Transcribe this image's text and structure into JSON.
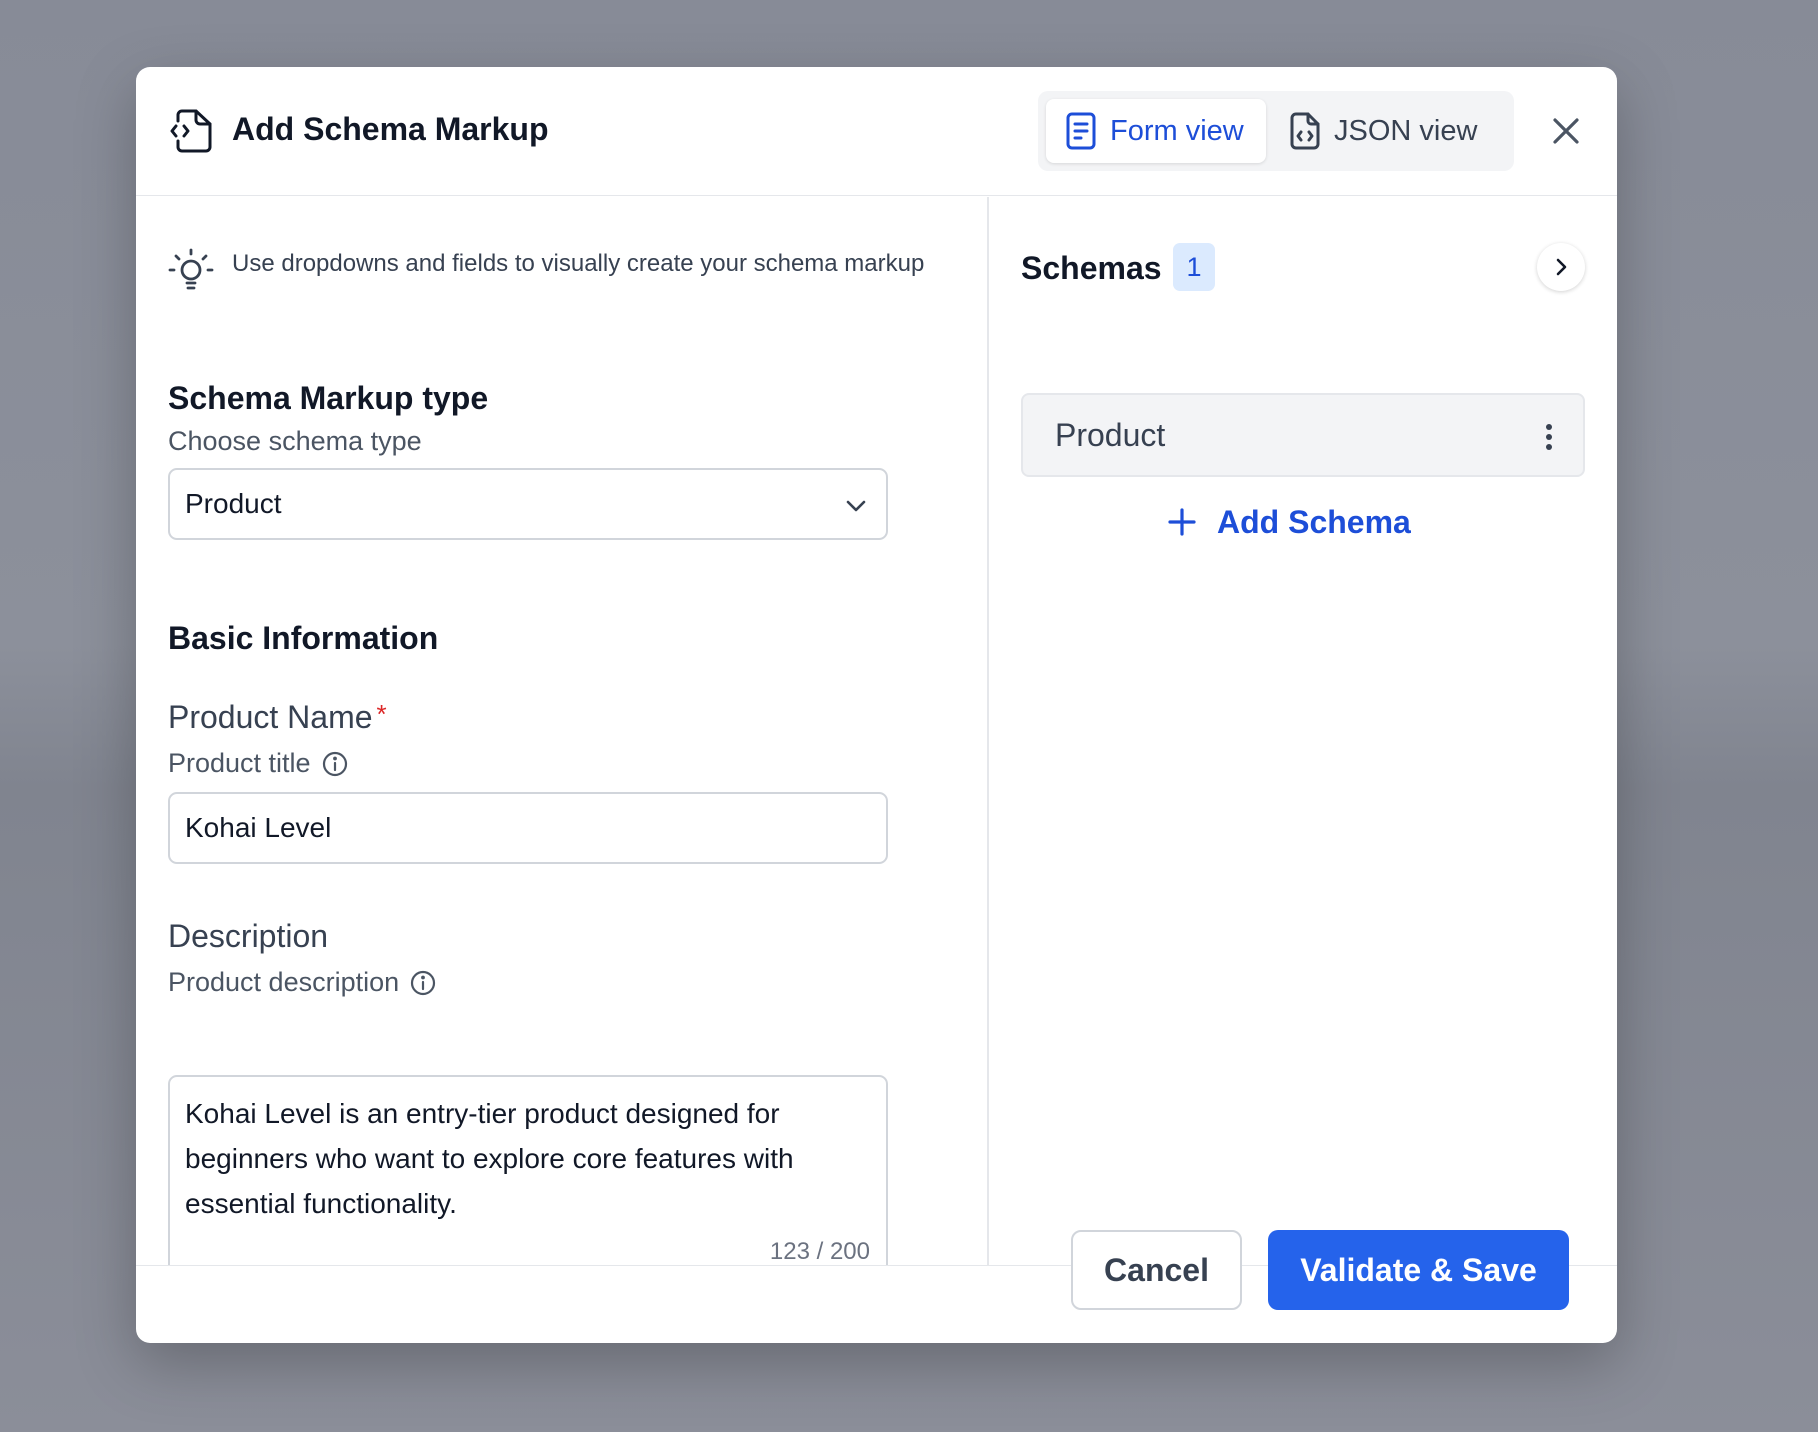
{
  "modal": {
    "title": "Add Schema Markup",
    "view_toggle": {
      "form_view_label": "Form view",
      "json_view_label": "JSON view",
      "active": "Form view"
    }
  },
  "form": {
    "tip": "Use dropdowns and fields to visually create your schema markup",
    "schema_type_section": {
      "title": "Schema Markup type",
      "help": "Choose schema type",
      "selected_value": "Product"
    },
    "basic_info_title": "Basic Information",
    "product_name": {
      "label": "Product Name",
      "required_mark": "*",
      "help": "Product title",
      "value": "Kohai Level"
    },
    "description": {
      "label": "Description",
      "help": "Product description",
      "value": "Kohai Level is an entry-tier product designed for beginners who want to explore core features with essential functionality.",
      "char_count": "123 / 200"
    }
  },
  "schemas_panel": {
    "title": "Schemas",
    "count": "1",
    "items": [
      {
        "label": "Product"
      }
    ],
    "add_label": "Add Schema"
  },
  "footer": {
    "cancel_label": "Cancel",
    "save_label": "Validate & Save"
  },
  "colors": {
    "accent": "#2563eb",
    "accent_text": "#1d4ed8",
    "required": "#dc2626",
    "badge_bg": "#dbeafe"
  }
}
